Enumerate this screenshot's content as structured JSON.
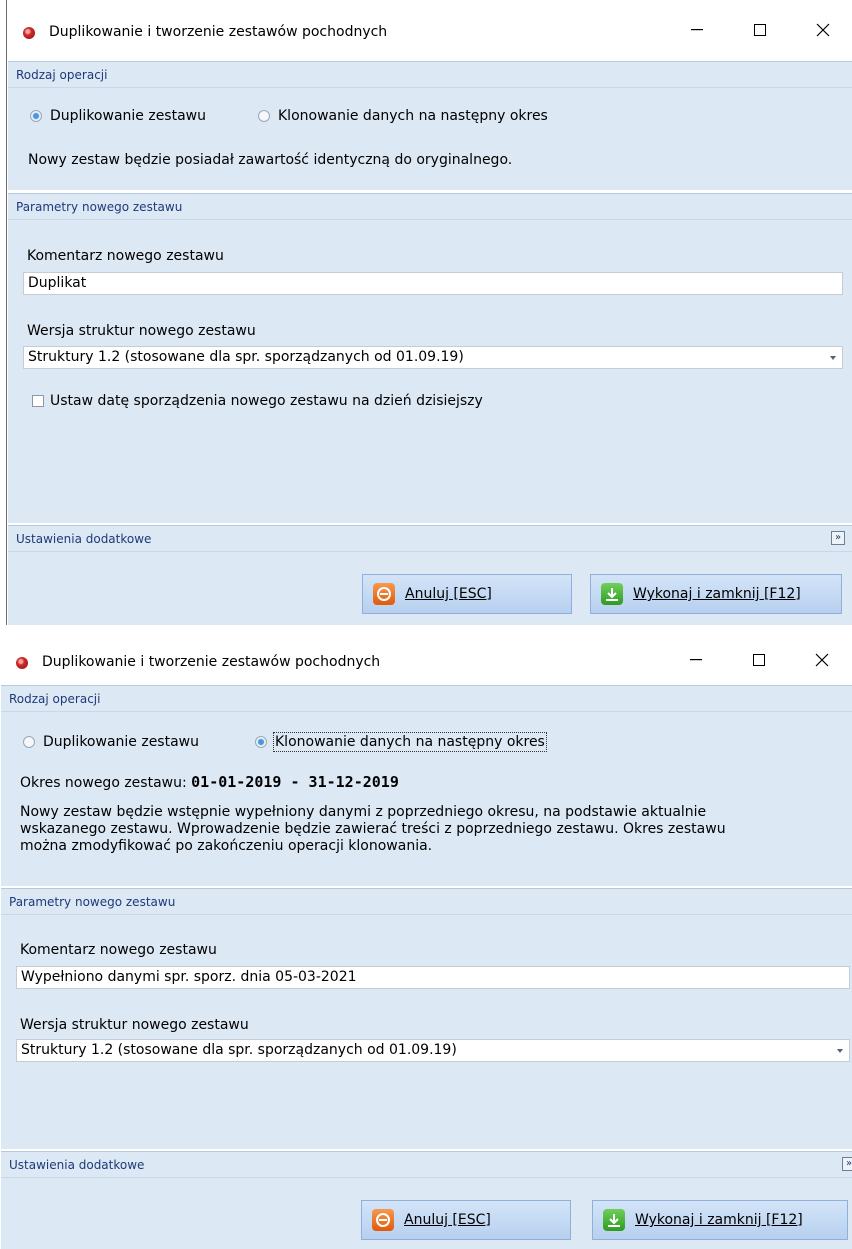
{
  "window1": {
    "title": "Duplikowanie i tworzenie zestawów pochodnych",
    "icons": {
      "app": "app-record-icon",
      "minimize": "minimize-icon",
      "maximize": "maximize-icon",
      "close": "close-icon"
    },
    "section_operation": "Rodzaj operacji",
    "radio_duplicate": "Duplikowanie zestawu",
    "radio_clone": "Klonowanie danych na następny okres",
    "selected": "Duplikowanie zestawu",
    "description": "Nowy zestaw będzie posiadał zawartość identyczną do oryginalnego.",
    "section_params": "Parametry nowego zestawu",
    "comment_label": "Komentarz nowego zestawu",
    "comment_value": "Duplikat",
    "version_label": "Wersja struktur nowego zestawu",
    "version_value": "Struktury 1.2 (stosowane dla spr. sporządzanych od 01.09.19)",
    "set_date_label": "Ustaw datę sporządzenia nowego zestawu na dzień dzisiejszy",
    "set_date_checked": false,
    "section_extra": "Ustawienia dodatkowe",
    "cancel_label": "Anuluj [ESC]",
    "execute_label": "Wykonaj i zamknij [F12]"
  },
  "window2": {
    "title": "Duplikowanie i tworzenie zestawów pochodnych",
    "section_operation": "Rodzaj operacji",
    "radio_duplicate": "Duplikowanie zestawu",
    "radio_clone": "Klonowanie danych na następny okres",
    "selected": "Klonowanie danych na następny okres",
    "period_label": "Okres nowego zestawu:",
    "period_value": "01-01-2019 - 31-12-2019",
    "description_lines": [
      "Nowy zestaw będzie wstępnie wypełniony danymi z poprzedniego okresu, na podstawie aktualnie",
      "wskazanego zestawu. Wprowadzenie będzie zawierać treści z poprzedniego zestawu. Okres zestawu",
      "można zmodyfikować po zakończeniu operacji klonowania."
    ],
    "section_params": "Parametry nowego zestawu",
    "comment_label": "Komentarz nowego zestawu",
    "comment_value": "Wypełniono danymi spr. sporz. dnia 05-03-2021",
    "version_label": "Wersja struktur nowego zestawu",
    "version_value": "Struktury 1.2 (stosowane dla spr. sporządzanych od 01.09.19)",
    "section_extra": "Ustawienia dodatkowe",
    "cancel_label": "Anuluj [ESC]",
    "execute_label": "Wykonaj i zamknij [F12]"
  },
  "colors": {
    "section_bg": "#dde8f5",
    "section_text": "#1e3a78",
    "button_bg": "#c6dbf4",
    "cancel_icon": "#e8661a",
    "execute_icon": "#3aa52c"
  }
}
